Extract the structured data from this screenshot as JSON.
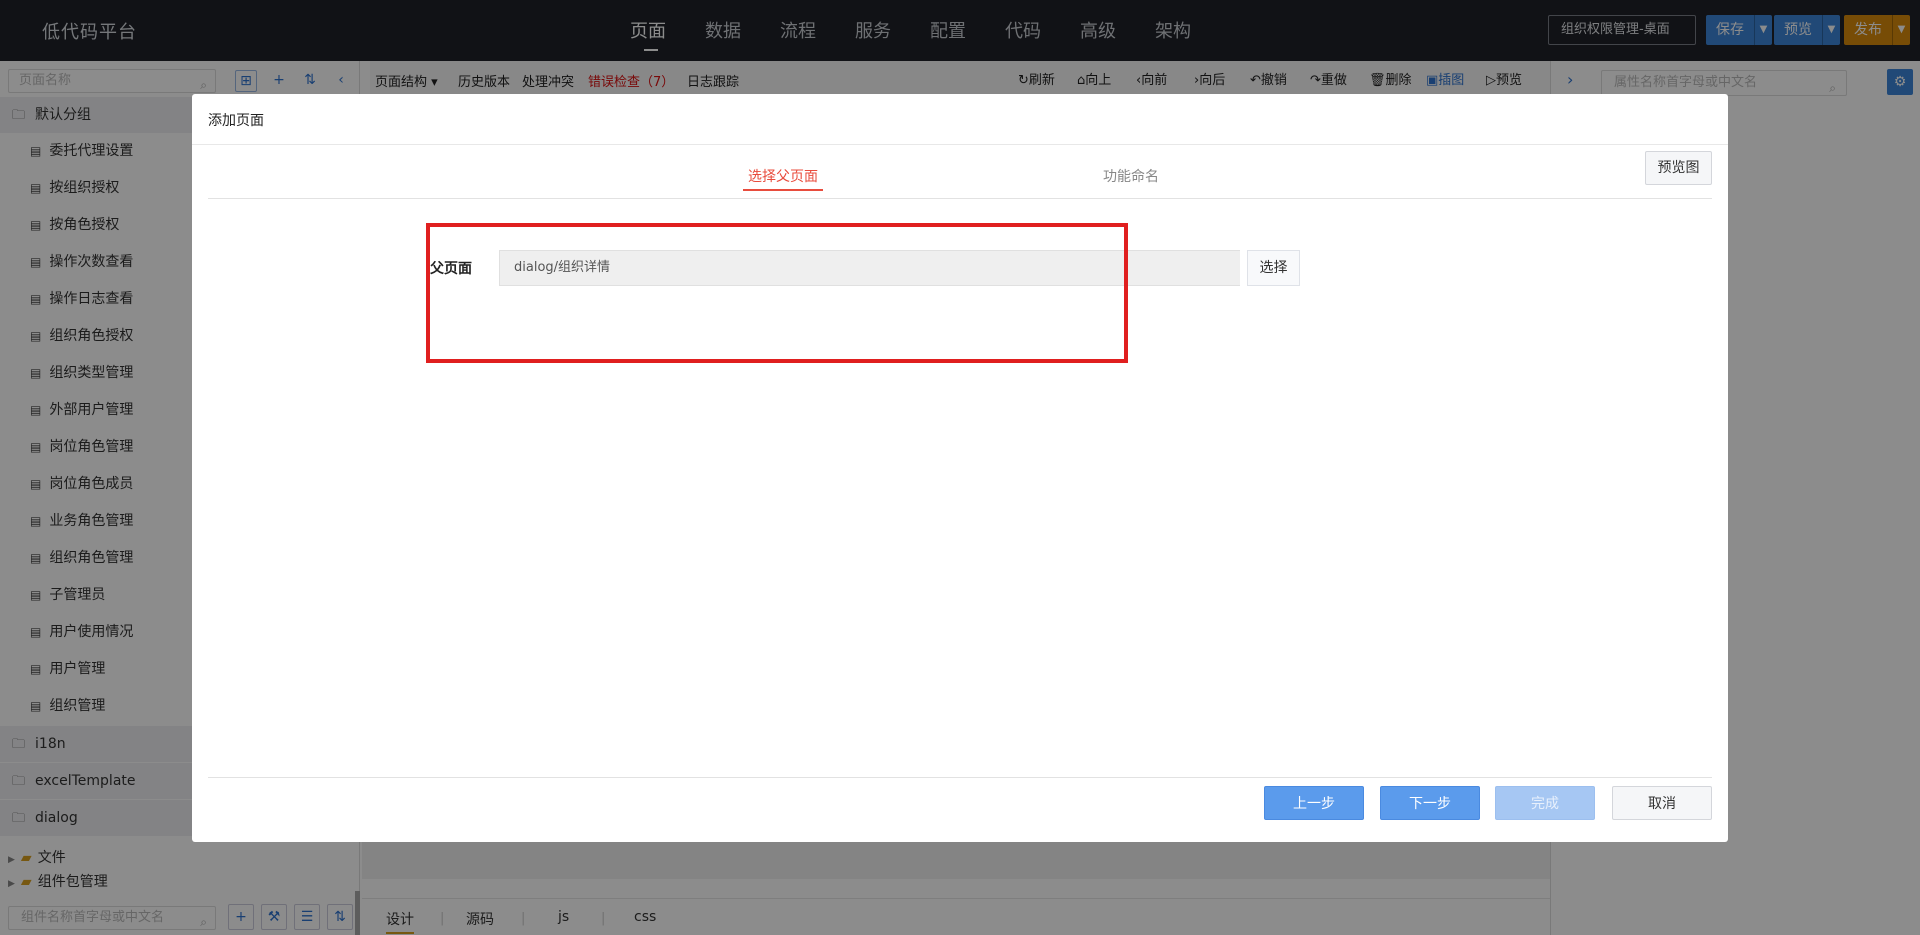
{
  "app": {
    "title": "低代码平台"
  },
  "nav": {
    "items": [
      "页面",
      "数据",
      "流程",
      "服务",
      "配置",
      "代码",
      "高级",
      "架构"
    ]
  },
  "header": {
    "project": "组织权限管理-桌面",
    "save": "保存",
    "preview": "预览",
    "publish": "发布"
  },
  "left": {
    "search_placeholder": "页面名称",
    "group_default": "默认分组",
    "pages": [
      "委托代理设置",
      "按组织授权",
      "按角色授权",
      "操作次数查看",
      "操作日志查看",
      "组织角色授权",
      "组织类型管理",
      "外部用户管理",
      "岗位角色管理",
      "岗位角色成员",
      "业务角色管理",
      "组织角色管理",
      "子管理员",
      "用户使用情况",
      "用户管理",
      "组织管理"
    ],
    "groups": [
      "i18n",
      "excelTemplate",
      "dialog"
    ],
    "tree": [
      "文件",
      "组件包管理"
    ],
    "component_search_placeholder": "组件名称首字母或中文名"
  },
  "toolbar": {
    "page_structure": "页面结构",
    "history": "历史版本",
    "conflict": "处理冲突",
    "error_check": "错误检查（7）",
    "log_trace": "日志跟踪",
    "refresh": "刷新",
    "up": "向上",
    "forward": "向前",
    "back": "向后",
    "undo": "撤销",
    "redo": "重做",
    "delete": "删除",
    "screenshot": "插图",
    "preview": "预览"
  },
  "right": {
    "search_placeholder": "属性名称首字母或中文名"
  },
  "bottom_tabs": [
    "设计",
    "源码",
    "js",
    "css"
  ],
  "modal": {
    "title": "添加页面",
    "steps": [
      "选择父页面",
      "功能命名"
    ],
    "preview_button": "预览图",
    "field_label": "父页面",
    "field_value": "dialog/组织详情",
    "select_button": "选择",
    "prev": "上一步",
    "next": "下一步",
    "finish": "完成",
    "cancel": "取消"
  },
  "colors": {
    "accent": "#e84c3d",
    "primary": "#5b9bec",
    "highlight_box": "#e01f1f",
    "topbar": "#1f2229"
  }
}
